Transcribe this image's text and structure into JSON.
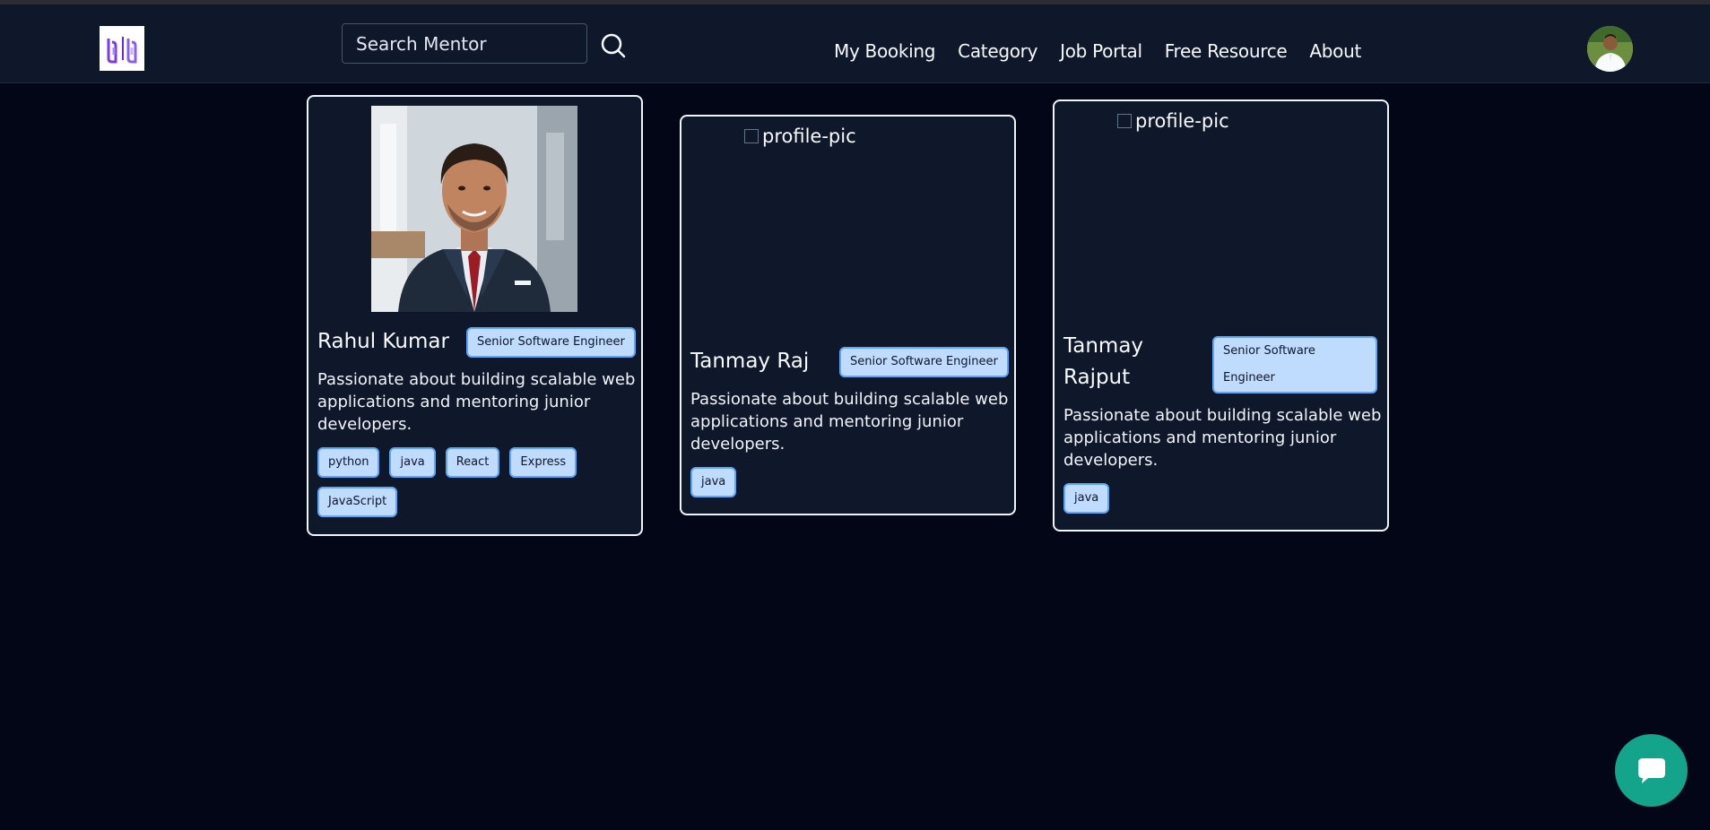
{
  "search": {
    "placeholder": "Search Mentor"
  },
  "nav": {
    "links": [
      "My Booking",
      "Category",
      "Job Portal",
      "Free Resource",
      "About"
    ]
  },
  "mentors": [
    {
      "name": "Rahul Kumar",
      "role": "Senior Software Engineer",
      "image_alt": "profile-pic",
      "description": "Passionate about building scalable web applications and mentoring junior developers.",
      "skills": [
        "python",
        "java",
        "React",
        "Express",
        "JavaScript"
      ]
    },
    {
      "name": "Tanmay Raj",
      "role": "Senior Software Engineer",
      "image_alt": "profile-pic",
      "description": "Passionate about building scalable web applications and mentoring junior developers.",
      "skills": [
        "java"
      ]
    },
    {
      "name": "Tanmay Rajput",
      "role": "Senior Software Engineer",
      "image_alt": "profile-pic",
      "description": "Passionate about building scalable web applications and mentoring junior developers.",
      "skills": [
        "java"
      ]
    }
  ],
  "colors": {
    "page_bg": "#020617",
    "navbar_bg": "#0f172a",
    "card_bg": "#0f172a",
    "badge_bg": "#bfdbfe",
    "badge_border": "#60a5fa",
    "chat_button": "#14a38b"
  },
  "icons": {
    "search": "search-icon",
    "chat": "chat-bubble-icon",
    "logo": "app-logo",
    "avatar": "user-avatar"
  }
}
